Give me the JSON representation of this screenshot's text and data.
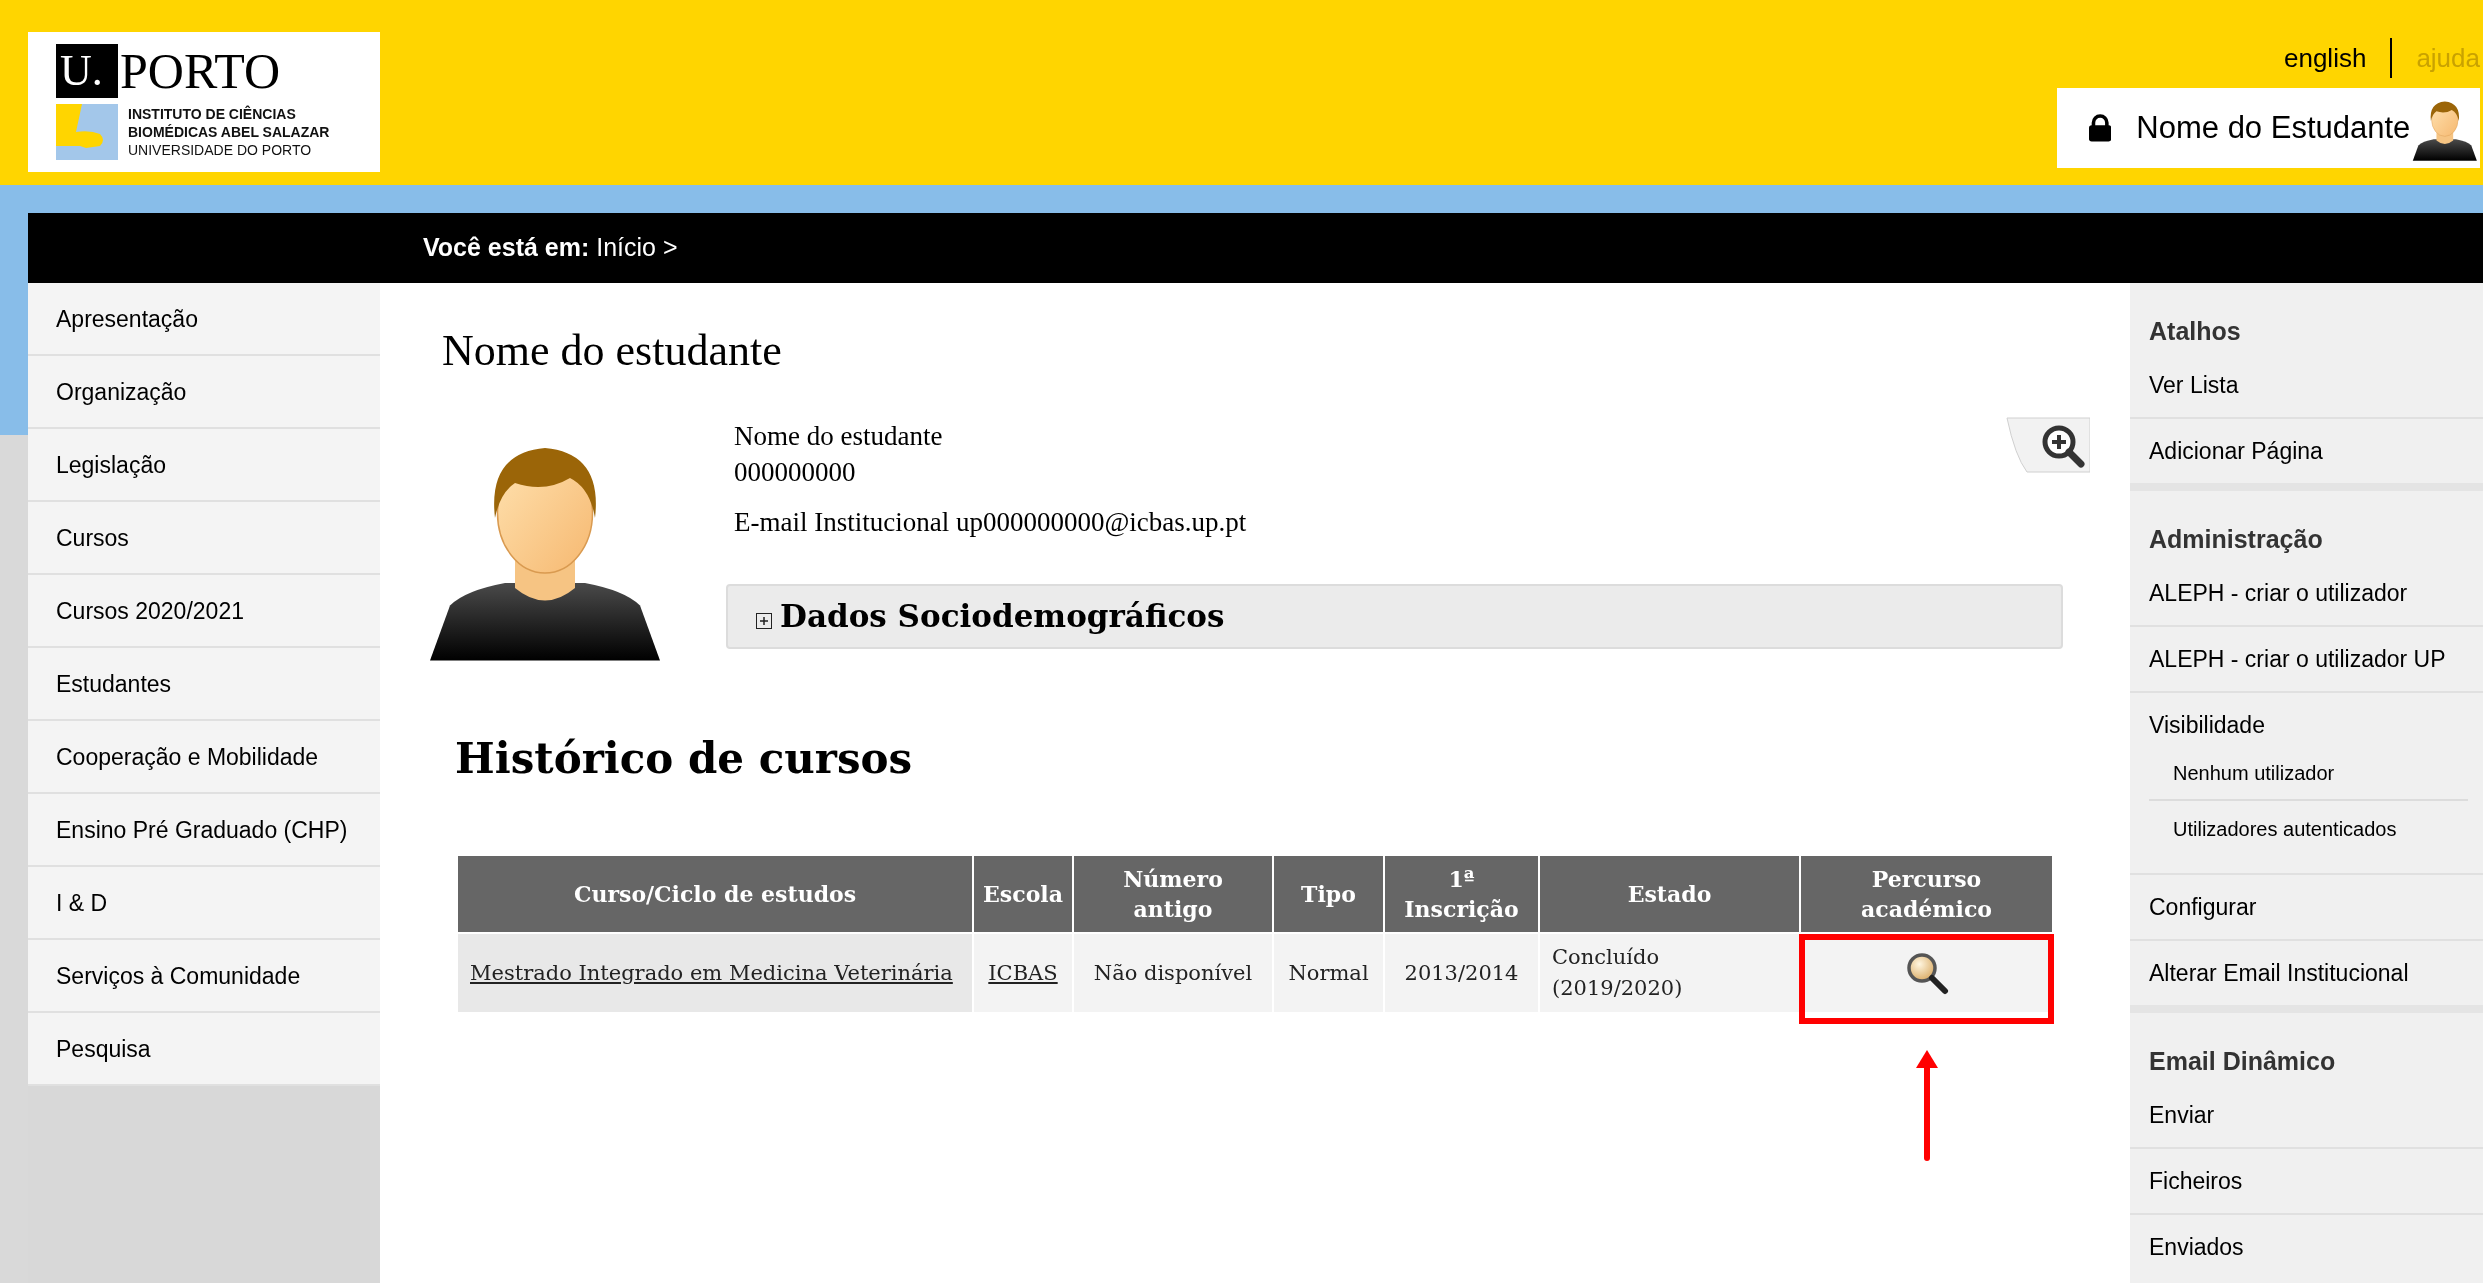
{
  "header": {
    "logo": {
      "initial": "U.",
      "wordmark": "PORTO",
      "lines": [
        "INSTITUTO DE CIÊNCIAS",
        "BIOMÉDICAS ABEL SALAZAR",
        "UNIVERSIDADE DO PORTO"
      ]
    },
    "links": [
      {
        "label": "english",
        "disabled": false
      },
      {
        "label": "ajuda",
        "disabled": true
      }
    ],
    "user": {
      "name": "Nome do Estudante"
    }
  },
  "breadcrumb": "**Você está em:** Início >",
  "left_nav": {
    "items": [
      {
        "label": "Apresentação"
      },
      {
        "label": "Organização"
      },
      {
        "label": "Legislação"
      },
      {
        "label": "Cursos"
      },
      {
        "label": "Cursos 2020/2021"
      },
      {
        "label": "Estudantes"
      },
      {
        "label": "Cooperação e Mobilidade"
      },
      {
        "label": "Ensino Pré Graduado (CHP)"
      },
      {
        "label": "I & D"
      },
      {
        "label": "Serviços à Comunidade"
      },
      {
        "label": "Pesquisa"
      }
    ]
  },
  "main": {
    "title": "Nome do estudante",
    "profile": {
      "name": "Nome do estudante",
      "number": "000000000",
      "email": "E-mail Institucional up000000000@icbas.up.pt"
    },
    "sections": [
      {
        "label": "Dados Sociodemográficos",
        "expanded": false
      }
    ],
    "history": {
      "title": "Histórico de cursos",
      "columns": [
        "Curso/Ciclo de estudos",
        "Escola",
        "Número antigo",
        "Tipo",
        "1ª Inscrição",
        "Estado",
        "Percurso académico"
      ],
      "rows": [
        {
          "cells": [
            {
              "kind": "link",
              "text": "Mestrado Integrado em Medicina Veterinária",
              "highlighted": false
            },
            {
              "kind": "link",
              "text": "ICBAS",
              "highlighted": false
            },
            {
              "kind": "text",
              "text": "Não disponível",
              "highlighted": false
            },
            {
              "kind": "text",
              "text": "Normal",
              "highlighted": false
            },
            {
              "kind": "text",
              "text": "2013/2014",
              "highlighted": false
            },
            {
              "kind": "text",
              "text": "Concluído (2019/2020)",
              "highlighted": false
            },
            {
              "kind": "icon",
              "highlighted": true
            }
          ]
        }
      ]
    }
  },
  "right_nav": {
    "sections": [
      {
        "title": "Atalhos",
        "items": [
          {
            "label": "Ver Lista"
          },
          {
            "label": "Adicionar Página"
          }
        ]
      },
      {
        "title": "Administração",
        "items": [
          {
            "label": "ALEPH - criar o utilizador"
          },
          {
            "label": "ALEPH - criar o utilizador UP"
          },
          {
            "label": "Visibilidade",
            "children": [
              {
                "label": "Nenhum utilizador"
              },
              {
                "label": "Utilizadores autenticados"
              }
            ]
          },
          {
            "label": "Configurar"
          },
          {
            "label": "Alterar Email Institucional"
          }
        ]
      },
      {
        "title": "Email Dinâmico",
        "items": [
          {
            "label": "Enviar"
          },
          {
            "label": "Ficheiros"
          },
          {
            "label": "Enviados"
          }
        ]
      }
    ]
  }
}
